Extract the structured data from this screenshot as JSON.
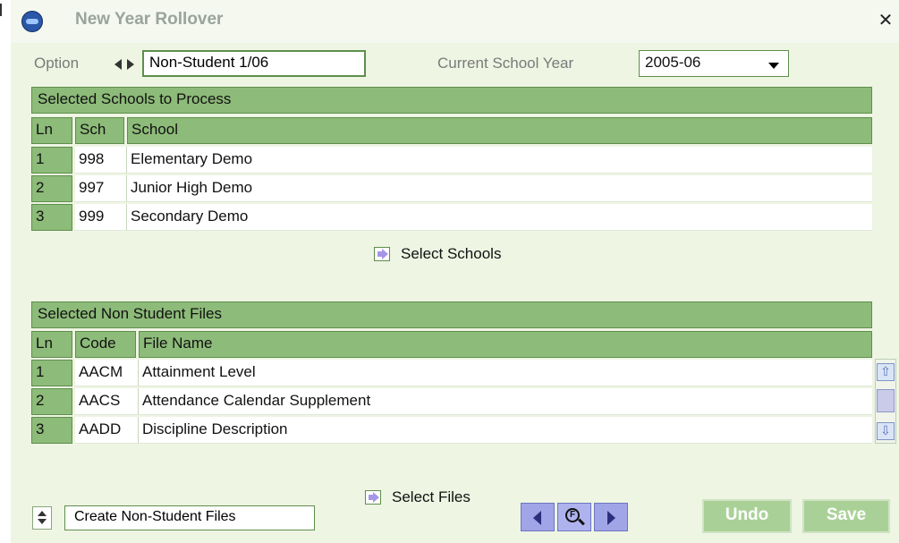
{
  "window": {
    "title": "New Year Rollover",
    "close_glyph": "✕"
  },
  "top": {
    "option_label": "Option",
    "option_value": "Non-Student 1/06",
    "school_year_label": "Current School Year",
    "school_year_value": "2005-06"
  },
  "schools": {
    "section_title": "Selected Schools to Process",
    "columns": [
      "Ln",
      "Sch",
      "School"
    ],
    "rows": [
      {
        "ln": "1",
        "code": "998",
        "name": "Elementary Demo"
      },
      {
        "ln": "2",
        "code": "997",
        "name": "Junior High Demo"
      },
      {
        "ln": "3",
        "code": "999",
        "name": "Secondary Demo"
      }
    ],
    "select_label": "Select Schools"
  },
  "files": {
    "section_title": "Selected Non Student Files",
    "columns": [
      "Ln",
      "Code",
      "File Name"
    ],
    "rows": [
      {
        "ln": "1",
        "code": "AACM",
        "name": "Attainment Level"
      },
      {
        "ln": "2",
        "code": "AACS",
        "name": "Attendance Calendar Supplement"
      },
      {
        "ln": "3",
        "code": "AADD",
        "name": "Discipline Description"
      }
    ],
    "select_label": "Select Files"
  },
  "footer": {
    "mode_value": "Create Non-Student Files",
    "find_glyph": "F",
    "undo_label": "Undo",
    "save_label": "Save"
  },
  "icons": {
    "scroll_up": "⇧",
    "scroll_down": "⇩"
  },
  "colors": {
    "header_green": "#8dbb79",
    "border_green": "#5e8f4c",
    "button_green": "#a9d197",
    "nav_purple": "#9fa5e6"
  }
}
